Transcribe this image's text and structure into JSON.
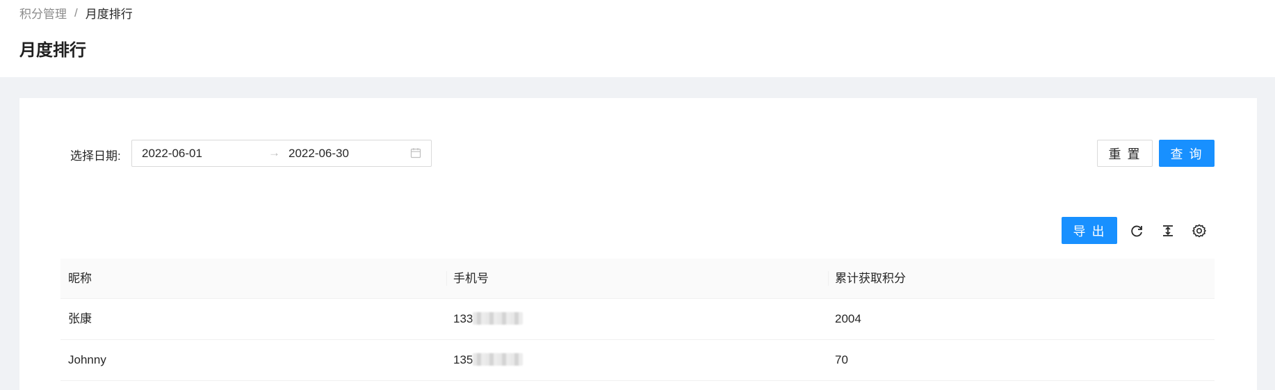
{
  "breadcrumb": {
    "parent": "积分管理",
    "separator": "/",
    "current": "月度排行"
  },
  "page_title": "月度排行",
  "filter": {
    "label": "选择日期:",
    "start_date": "2022-06-01",
    "arrow": "→",
    "end_date": "2022-06-30",
    "icon": "calendar-icon"
  },
  "buttons": {
    "reset": "重 置",
    "query": "查 询",
    "export": "导 出"
  },
  "toolbar_icons": [
    "reload-icon",
    "density-icon",
    "settings-icon"
  ],
  "table": {
    "columns": [
      "昵称",
      "手机号",
      "累计获取积分"
    ],
    "rows": [
      {
        "nickname": "张康",
        "phone_prefix": "133",
        "points": "2004"
      },
      {
        "nickname": "Johnny",
        "phone_prefix": "135",
        "points": "70"
      }
    ]
  },
  "colors": {
    "primary": "#1890ff",
    "background": "#f0f2f5"
  }
}
